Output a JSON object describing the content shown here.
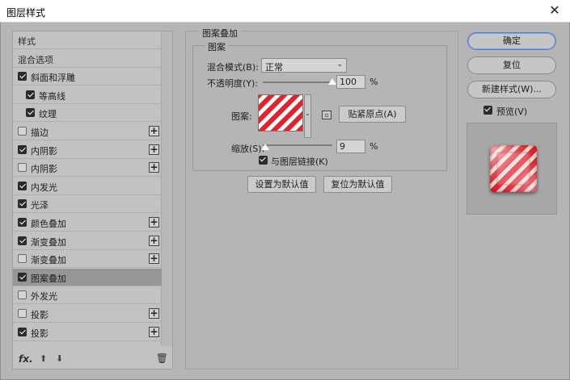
{
  "window": {
    "title": "图层样式",
    "close_glyph": "✕"
  },
  "style_list": {
    "items": [
      {
        "label": "样式",
        "type": "header",
        "checked": false,
        "has_plus": false,
        "selected": false,
        "indent": 0
      },
      {
        "label": "混合选项",
        "type": "header",
        "checked": false,
        "has_plus": false,
        "selected": false,
        "indent": 0
      },
      {
        "label": "斜面和浮雕",
        "type": "effect",
        "checked": true,
        "has_plus": false,
        "selected": false,
        "indent": 0
      },
      {
        "label": "等高线",
        "type": "effect",
        "checked": true,
        "has_plus": false,
        "selected": false,
        "indent": 1
      },
      {
        "label": "纹理",
        "type": "effect",
        "checked": true,
        "has_plus": false,
        "selected": false,
        "indent": 1
      },
      {
        "label": "描边",
        "type": "effect",
        "checked": false,
        "has_plus": true,
        "selected": false,
        "indent": 0
      },
      {
        "label": "内阴影",
        "type": "effect",
        "checked": true,
        "has_plus": true,
        "selected": false,
        "indent": 0
      },
      {
        "label": "内阴影",
        "type": "effect",
        "checked": false,
        "has_plus": true,
        "selected": false,
        "indent": 0
      },
      {
        "label": "内发光",
        "type": "effect",
        "checked": true,
        "has_plus": false,
        "selected": false,
        "indent": 0
      },
      {
        "label": "光泽",
        "type": "effect",
        "checked": true,
        "has_plus": false,
        "selected": false,
        "indent": 0
      },
      {
        "label": "颜色叠加",
        "type": "effect",
        "checked": true,
        "has_plus": true,
        "selected": false,
        "indent": 0
      },
      {
        "label": "渐变叠加",
        "type": "effect",
        "checked": true,
        "has_plus": true,
        "selected": false,
        "indent": 0
      },
      {
        "label": "渐变叠加",
        "type": "effect",
        "checked": false,
        "has_plus": true,
        "selected": false,
        "indent": 0
      },
      {
        "label": "图案叠加",
        "type": "effect",
        "checked": true,
        "has_plus": false,
        "selected": true,
        "indent": 0
      },
      {
        "label": "外发光",
        "type": "effect",
        "checked": false,
        "has_plus": false,
        "selected": false,
        "indent": 0
      },
      {
        "label": "投影",
        "type": "effect",
        "checked": false,
        "has_plus": true,
        "selected": false,
        "indent": 0
      },
      {
        "label": "投影",
        "type": "effect",
        "checked": true,
        "has_plus": true,
        "selected": false,
        "indent": 0
      }
    ],
    "footer": {
      "fx_label": "fx",
      "fx_suffix": ".",
      "move_up_glyph": "⬆",
      "move_down_glyph": "⬇",
      "delete_glyph": "🗑"
    }
  },
  "pattern_overlay": {
    "section_title": "图案叠加",
    "group_title": "图案",
    "blend_mode_label": "混合模式(B):",
    "blend_mode_value": "正常",
    "opacity_label": "不透明度(Y):",
    "opacity_value": "100",
    "opacity_unit": "%",
    "opacity_fraction": 1.0,
    "pattern_label": "图案:",
    "snap_origin_button": "贴紧原点(A)",
    "scale_label": "缩放(S):",
    "scale_value": "9",
    "scale_unit": "%",
    "link_label": "与图层链接(K)",
    "link_checked": true,
    "set_default_button": "设置为默认值",
    "reset_default_button": "复位为默认值",
    "pattern_colors": [
      "#e3232a",
      "#ffffff"
    ]
  },
  "actions": {
    "ok": "确定",
    "reset": "复位",
    "new_style": "新建样式(W)...",
    "preview_label": "预览(V)",
    "preview_checked": true
  },
  "colors": {
    "dialog_bg": "#b5b5b5",
    "selected_row": "#969696",
    "primary_border": "#4a7fd0"
  }
}
